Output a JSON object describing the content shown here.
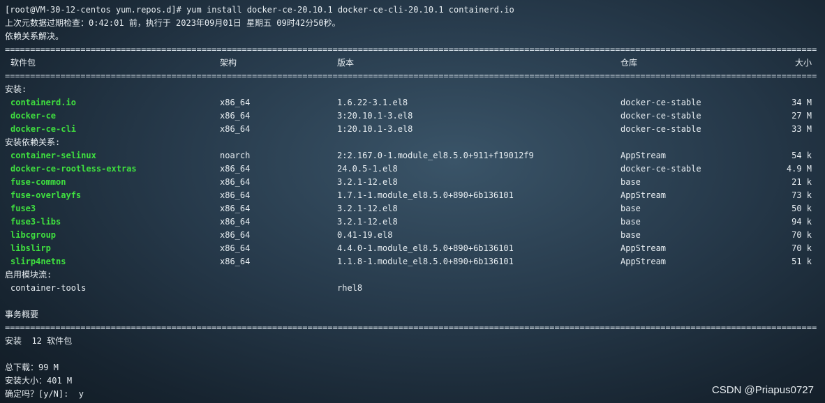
{
  "terminal": {
    "prompt_line": "[root@VM-30-12-centos yum.repos.d]# yum install docker-ce-20.10.1 docker-ce-cli-20.10.1 containerd.io",
    "metadata_line": "上次元数据过期检查：0:42:01 前，执行于 2023年09月01日 星期五 09时42分50秒。",
    "deps_resolved": "依赖关系解决。",
    "separator": "================================================================================================================================================================================================================================================================",
    "headers": {
      "package": "软件包",
      "arch": "架构",
      "version": "版本",
      "repo": "仓库",
      "size": "大小"
    },
    "installing_label": "安装:",
    "installing": [
      {
        "name": "containerd.io",
        "arch": "x86_64",
        "version": "1.6.22-3.1.el8",
        "repo": "docker-ce-stable",
        "size": "34 M"
      },
      {
        "name": "docker-ce",
        "arch": "x86_64",
        "version": "3:20.10.1-3.el8",
        "repo": "docker-ce-stable",
        "size": "27 M"
      },
      {
        "name": "docker-ce-cli",
        "arch": "x86_64",
        "version": "1:20.10.1-3.el8",
        "repo": "docker-ce-stable",
        "size": "33 M"
      }
    ],
    "deps_label": "安装依赖关系:",
    "dependencies": [
      {
        "name": "container-selinux",
        "arch": "noarch",
        "version": "2:2.167.0-1.module_el8.5.0+911+f19012f9",
        "repo": "AppStream",
        "size": "54 k"
      },
      {
        "name": "docker-ce-rootless-extras",
        "arch": "x86_64",
        "version": "24.0.5-1.el8",
        "repo": "docker-ce-stable",
        "size": "4.9 M"
      },
      {
        "name": "fuse-common",
        "arch": "x86_64",
        "version": "3.2.1-12.el8",
        "repo": "base",
        "size": "21 k"
      },
      {
        "name": "fuse-overlayfs",
        "arch": "x86_64",
        "version": "1.7.1-1.module_el8.5.0+890+6b136101",
        "repo": "AppStream",
        "size": "73 k"
      },
      {
        "name": "fuse3",
        "arch": "x86_64",
        "version": "3.2.1-12.el8",
        "repo": "base",
        "size": "50 k"
      },
      {
        "name": "fuse3-libs",
        "arch": "x86_64",
        "version": "3.2.1-12.el8",
        "repo": "base",
        "size": "94 k"
      },
      {
        "name": "libcgroup",
        "arch": "x86_64",
        "version": "0.41-19.el8",
        "repo": "base",
        "size": "70 k"
      },
      {
        "name": "libslirp",
        "arch": "x86_64",
        "version": "4.4.0-1.module_el8.5.0+890+6b136101",
        "repo": "AppStream",
        "size": "70 k"
      },
      {
        "name": "slirp4netns",
        "arch": "x86_64",
        "version": "1.1.8-1.module_el8.5.0+890+6b136101",
        "repo": "AppStream",
        "size": "51 k"
      }
    ],
    "module_label": "启用模块流:",
    "module": {
      "name": "container-tools",
      "stream": "rhel8"
    },
    "summary_label": "事务概要",
    "install_summary": "安装  12 软件包",
    "total_download": "总下载：99 M",
    "installed_size": "安装大小：401 M",
    "confirm_prompt": "确定吗？[y/N]:  y"
  },
  "watermark": "CSDN @Priapus0727"
}
